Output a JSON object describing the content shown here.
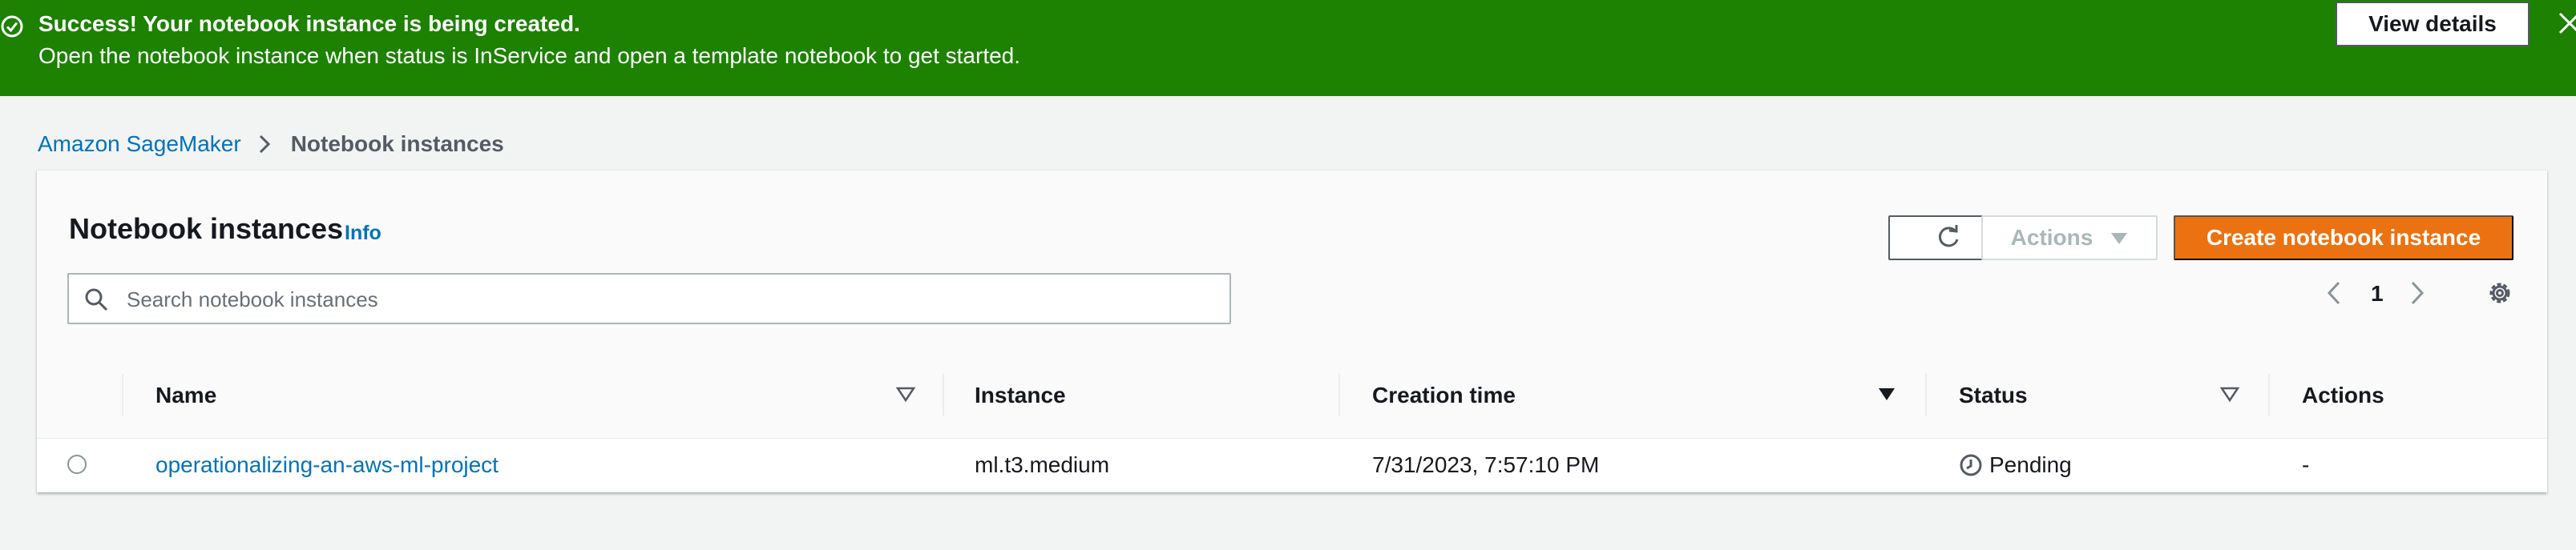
{
  "flash": {
    "title": "Success! Your notebook instance is being created.",
    "message": "Open the notebook instance when status is InService and open a template notebook to get started.",
    "view_details_label": "View details",
    "icon": "success-check-icon",
    "close_icon": "close-icon",
    "background_color": "#1d8102"
  },
  "breadcrumb": {
    "root": "Amazon SageMaker",
    "current": "Notebook instances"
  },
  "panel": {
    "title": "Notebook instances",
    "info": "Info",
    "refresh_icon": "refresh-icon",
    "actions_label": "Actions",
    "create_label": "Create notebook instance",
    "create_color": "#ec7211",
    "search_placeholder": "Search notebook instances",
    "search_value": "",
    "page": "1"
  },
  "table": {
    "columns": [
      "Name",
      "Instance",
      "Creation time",
      "Status",
      "Actions"
    ],
    "sorted_column": "Creation time",
    "rows": [
      {
        "name": "operationalizing-an-aws-ml-project",
        "instance": "ml.t3.medium",
        "creation_time": "7/31/2023, 7:57:10 PM",
        "status": "Pending",
        "actions": "-"
      }
    ]
  }
}
